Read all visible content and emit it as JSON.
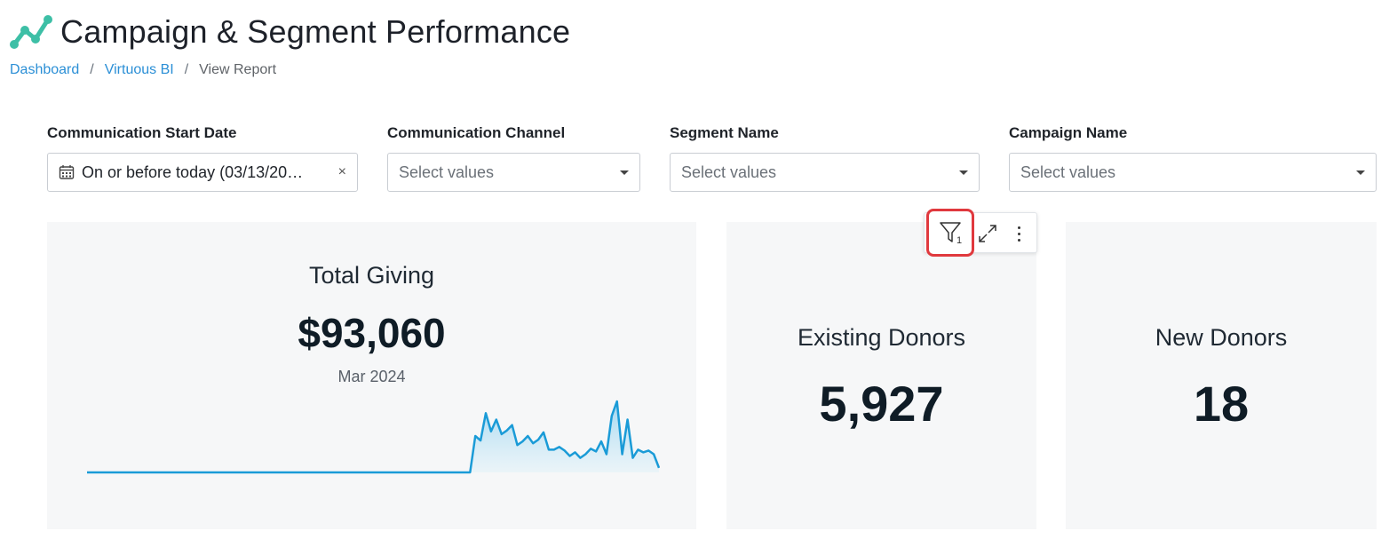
{
  "header": {
    "title": "Campaign & Segment Performance"
  },
  "breadcrumb": {
    "items": [
      "Dashboard",
      "Virtuous BI",
      "View Report"
    ],
    "separator": "/"
  },
  "filters": [
    {
      "label": "Communication Start Date",
      "value": "On or before today (03/13/20…",
      "type": "date"
    },
    {
      "label": "Communication Channel",
      "placeholder": "Select values"
    },
    {
      "label": "Segment Name",
      "placeholder": "Select values"
    },
    {
      "label": "Campaign Name",
      "placeholder": "Select values"
    }
  ],
  "toolbar": {
    "filter_count": "1"
  },
  "cards": {
    "total_giving": {
      "title": "Total Giving",
      "value": "$93,060",
      "period": "Mar 2024"
    },
    "existing_donors": {
      "title": "Existing Donors",
      "value": "5,927"
    },
    "new_donors": {
      "title": "New Donors",
      "value": "18"
    }
  },
  "colors": {
    "accent": "#2b8fd6",
    "sparkline": "#1a9bd7",
    "logo": "#3dbfa6",
    "highlight": "#e0393e"
  },
  "chart_data": {
    "type": "area",
    "values": [
      0,
      0,
      0,
      0,
      0,
      0,
      0,
      0,
      0,
      0,
      0,
      0,
      0,
      0,
      0,
      0,
      0,
      0,
      0,
      0,
      0,
      0,
      0,
      0,
      0,
      0,
      0,
      0,
      0,
      0,
      0,
      0,
      0,
      0,
      0,
      0,
      0,
      0,
      0,
      0,
      0,
      0,
      0,
      0,
      0,
      0,
      0,
      0,
      0,
      0,
      0,
      0,
      0,
      0,
      0,
      0,
      0,
      0,
      0,
      0,
      0,
      0,
      0,
      0,
      0,
      0,
      0,
      0,
      0,
      0,
      0,
      0,
      0,
      0,
      40,
      35,
      65,
      45,
      58,
      42,
      46,
      52,
      30,
      34,
      40,
      32,
      36,
      44,
      25,
      25,
      28,
      24,
      18,
      22,
      16,
      20,
      26,
      23,
      34,
      20,
      62,
      78,
      20,
      58,
      16,
      25,
      22,
      24,
      20,
      5
    ]
  }
}
